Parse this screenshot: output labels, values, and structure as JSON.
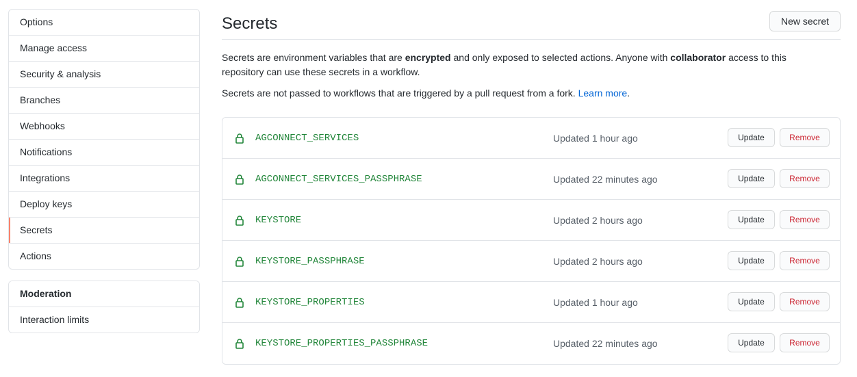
{
  "sidebar": {
    "items": [
      {
        "label": "Options"
      },
      {
        "label": "Manage access"
      },
      {
        "label": "Security & analysis"
      },
      {
        "label": "Branches"
      },
      {
        "label": "Webhooks"
      },
      {
        "label": "Notifications"
      },
      {
        "label": "Integrations"
      },
      {
        "label": "Deploy keys"
      },
      {
        "label": "Secrets",
        "selected": true
      },
      {
        "label": "Actions"
      }
    ],
    "moderation": {
      "heading": "Moderation",
      "items": [
        {
          "label": "Interaction limits"
        }
      ]
    }
  },
  "header": {
    "title": "Secrets",
    "new_secret_label": "New secret"
  },
  "description": {
    "p1_part1": "Secrets are environment variables that are ",
    "p1_bold1": "encrypted",
    "p1_part2": " and only exposed to selected actions. Anyone with ",
    "p1_bold2": "collaborator",
    "p1_part3": " access to this repository can use these secrets in a workflow.",
    "p2_text": "Secrets are not passed to workflows that are triggered by a pull request from a fork. ",
    "p2_link": "Learn more",
    "p2_end": "."
  },
  "secrets": [
    {
      "name": "AGCONNECT_SERVICES",
      "updated": "Updated 1 hour ago"
    },
    {
      "name": "AGCONNECT_SERVICES_PASSPHRASE",
      "updated": "Updated 22 minutes ago"
    },
    {
      "name": "KEYSTORE",
      "updated": "Updated 2 hours ago"
    },
    {
      "name": "KEYSTORE_PASSPHRASE",
      "updated": "Updated 2 hours ago"
    },
    {
      "name": "KEYSTORE_PROPERTIES",
      "updated": "Updated 1 hour ago"
    },
    {
      "name": "KEYSTORE_PROPERTIES_PASSPHRASE",
      "updated": "Updated 22 minutes ago"
    }
  ],
  "buttons": {
    "update_label": "Update",
    "remove_label": "Remove"
  },
  "colors": {
    "secret_name": "#22863a",
    "remove": "#cb2431",
    "link": "#0366d6",
    "selected_indicator": "#f9826c"
  }
}
